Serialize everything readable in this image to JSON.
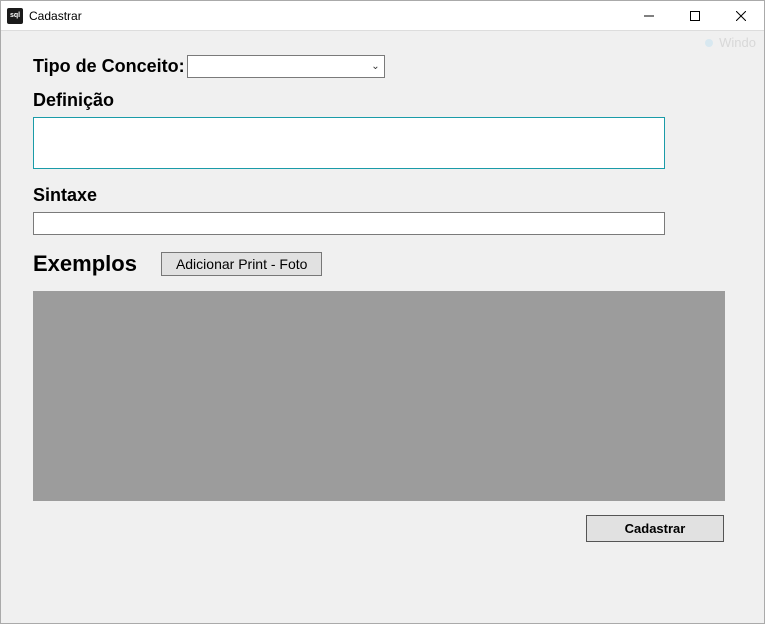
{
  "window": {
    "title": "Cadastrar",
    "icon_label": "sql"
  },
  "form": {
    "tipo_label": "Tipo de Conceito:",
    "tipo_value": "",
    "definicao_label": "Definição",
    "definicao_value": "",
    "sintaxe_label": "Sintaxe",
    "sintaxe_value": "",
    "exemplos_label": "Exemplos",
    "add_print_label": "Adicionar Print - Foto",
    "cadastrar_label": "Cadastrar"
  },
  "ghost_text": "Windo"
}
